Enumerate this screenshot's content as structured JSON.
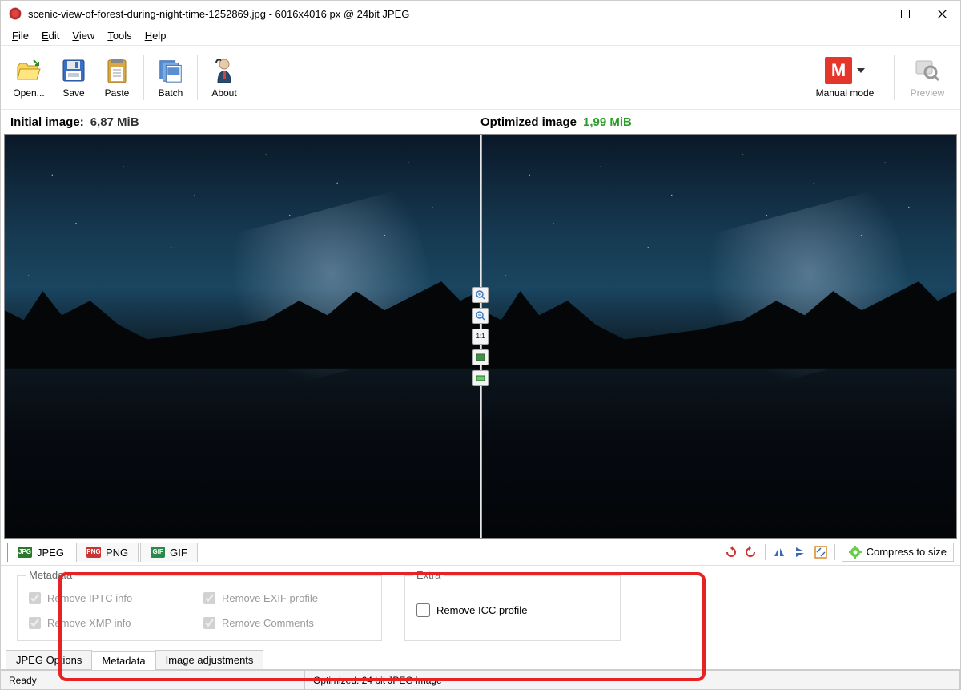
{
  "titlebar": {
    "title": "scenic-view-of-forest-during-night-time-1252869.jpg - 6016x4016 px @ 24bit JPEG"
  },
  "menu": {
    "file": "File",
    "edit": "Edit",
    "view": "View",
    "tools": "Tools",
    "help": "Help"
  },
  "toolbar": {
    "open": "Open...",
    "save": "Save",
    "paste": "Paste",
    "batch": "Batch",
    "about": "About",
    "mode": "Manual mode",
    "preview": "Preview"
  },
  "info": {
    "initial_label": "Initial image:",
    "initial_size": "6,87 MiB",
    "optimized_label": "Optimized image",
    "optimized_size": "1,99 MiB"
  },
  "center_tools": {
    "ratio": "1:1"
  },
  "format_tabs": {
    "jpeg": "JPEG",
    "png": "PNG",
    "gif": "GIF"
  },
  "right_tools": {
    "compress": "Compress to size"
  },
  "settings": {
    "metadata_legend": "Metadata",
    "extra_legend": "Extra",
    "remove_iptc": "Remove IPTC info",
    "remove_exif": "Remove EXIF profile",
    "remove_xmp": "Remove XMP info",
    "remove_comments": "Remove Comments",
    "remove_icc": "Remove ICC profile"
  },
  "bottom_tabs": {
    "jpeg_options": "JPEG Options",
    "metadata": "Metadata",
    "image_adjustments": "Image adjustments"
  },
  "status": {
    "ready": "Ready",
    "optimized": "Optimized: 24 bit JPEG image"
  }
}
